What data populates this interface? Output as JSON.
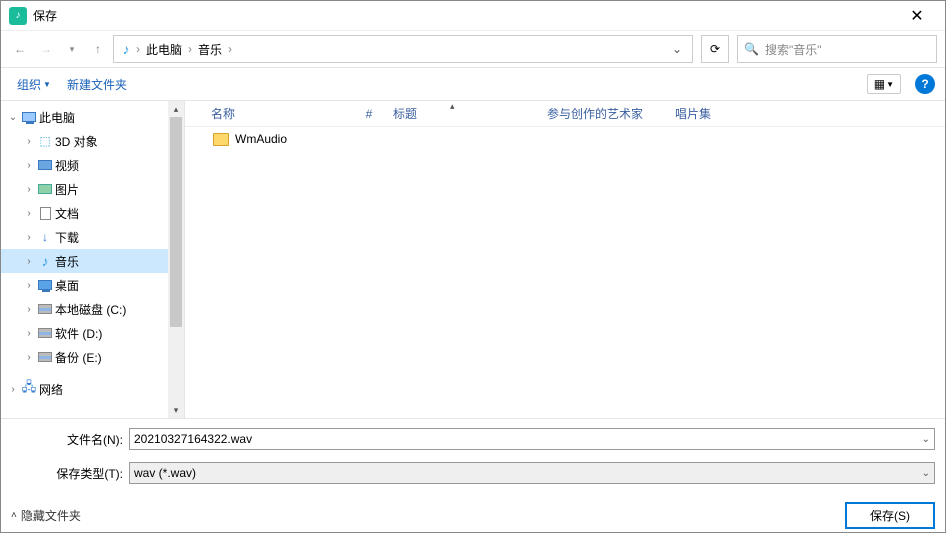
{
  "window": {
    "title": "保存",
    "close": "✕"
  },
  "nav": {
    "path_segments": [
      "此电脑",
      "音乐"
    ],
    "search_placeholder": "搜索\"音乐\""
  },
  "toolbar": {
    "organize": "组织",
    "new_folder": "新建文件夹"
  },
  "tree": {
    "this_pc": "此电脑",
    "items": [
      {
        "label": "3D 对象",
        "icon": "cube3d"
      },
      {
        "label": "视频",
        "icon": "video"
      },
      {
        "label": "图片",
        "icon": "pic"
      },
      {
        "label": "文档",
        "icon": "doc"
      },
      {
        "label": "下载",
        "icon": "dl"
      },
      {
        "label": "音乐",
        "icon": "music",
        "selected": true
      },
      {
        "label": "桌面",
        "icon": "desk"
      },
      {
        "label": "本地磁盘 (C:)",
        "icon": "disk"
      },
      {
        "label": "软件 (D:)",
        "icon": "disk"
      },
      {
        "label": "备份 (E:)",
        "icon": "disk"
      }
    ],
    "network": "网络"
  },
  "columns": {
    "name": "名称",
    "num": "#",
    "title": "标题",
    "artist": "参与创作的艺术家",
    "album": "唱片集"
  },
  "files": [
    {
      "name": "WmAudio",
      "type": "folder"
    }
  ],
  "form": {
    "filename_label": "文件名(N):",
    "filename_value": "20210327164322.wav",
    "type_label": "保存类型(T):",
    "type_value": "wav (*.wav)"
  },
  "footer": {
    "hide_folders": "隐藏文件夹",
    "save": "保存(S)"
  }
}
